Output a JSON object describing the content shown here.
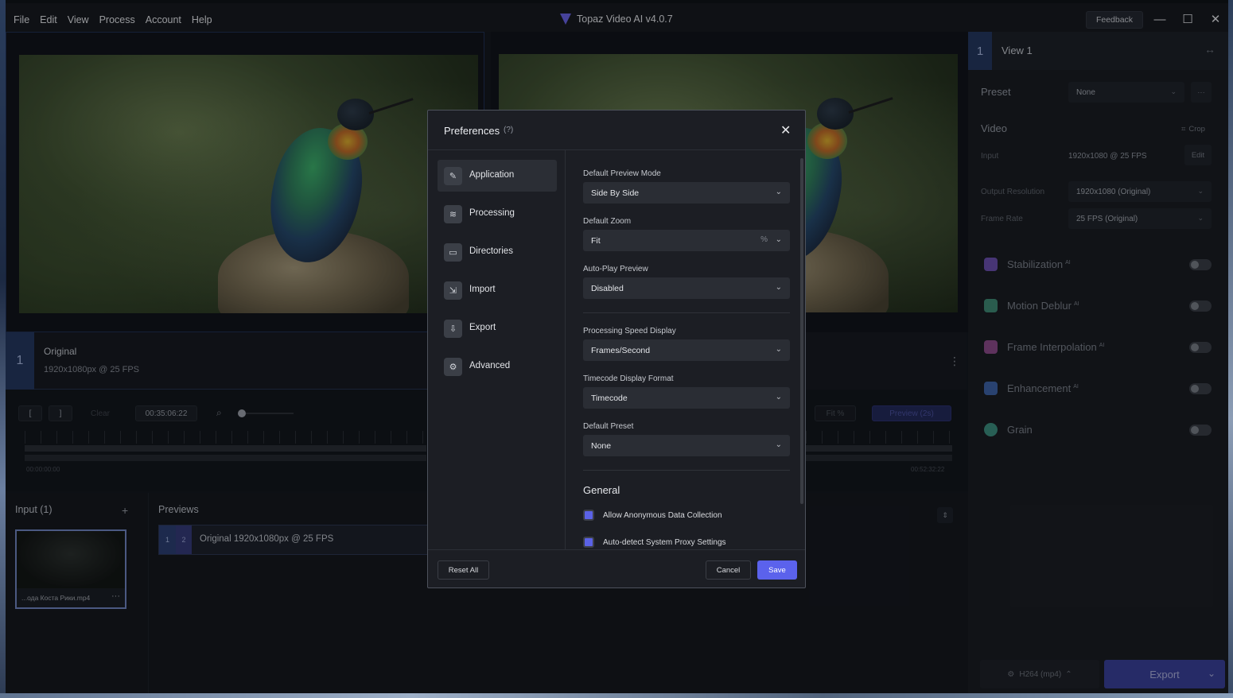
{
  "menu": [
    "File",
    "Edit",
    "View",
    "Process",
    "Account",
    "Help"
  ],
  "app_title": "Topaz Video AI  v4.0.7",
  "feedback_label": "Feedback",
  "window_controls": {
    "minimize": "—",
    "maximize": "☐",
    "close": "✕"
  },
  "view_strip": {
    "number": "1",
    "title": "Original",
    "subtitle": "1920x1080px @ 25 FPS"
  },
  "timeline": {
    "in_mark": "[",
    "out_mark": "]",
    "clear": "Clear",
    "timecode": "00:35:06:22",
    "start_tc": "00:00:00:00",
    "end_tc": "00:52:32:22",
    "fit": "Fit %",
    "preview": "Preview (2s)"
  },
  "input_panel": {
    "title": "Input (1)",
    "add": "+",
    "file_name": "...ода Коста Рики.mp4",
    "more": "···"
  },
  "previews_panel": {
    "title": "Previews",
    "num1": "1",
    "num2": "2",
    "row_label": "Original   1920x1080px @ 25 FPS",
    "sort": "⇕"
  },
  "sidebar": {
    "view_number": "1",
    "view_name": "View 1",
    "swap": "↔",
    "preset_label": "Preset",
    "preset_value": "None",
    "preset_more": "···",
    "video_label": "Video",
    "crop": "Crop",
    "input_label": "Input",
    "input_value": "1920x1080 @ 25 FPS",
    "edit": "Edit",
    "output_res_label": "Output Resolution",
    "output_res_value": "1920x1080 (Original)",
    "frame_rate_label": "Frame Rate",
    "frame_rate_value": "25 FPS (Original)",
    "features": [
      {
        "name": "Stabilization",
        "ai": "AI",
        "color": "#6c4fb0"
      },
      {
        "name": "Motion Deblur",
        "ai": "AI",
        "color": "#3f8a74"
      },
      {
        "name": "Frame Interpolation",
        "ai": "AI",
        "color": "#8f4b8a"
      },
      {
        "name": "Enhancement",
        "ai": "AI",
        "color": "#3e63a8"
      },
      {
        "name": "Grain",
        "ai": "",
        "color": "#3d8f7e"
      }
    ],
    "codec": "H264 (mp4)",
    "export": "Export"
  },
  "preferences": {
    "title": "Preferences",
    "help": "(?)",
    "close": "✕",
    "nav": [
      {
        "label": "Application",
        "icon": "✎"
      },
      {
        "label": "Processing",
        "icon": "≋"
      },
      {
        "label": "Directories",
        "icon": "▭"
      },
      {
        "label": "Import",
        "icon": "⇲"
      },
      {
        "label": "Export",
        "icon": "⇩"
      },
      {
        "label": "Advanced",
        "icon": "⚙"
      }
    ],
    "fields": [
      {
        "label": "Default Preview Mode",
        "value": "Side By Side"
      },
      {
        "label": "Default Zoom",
        "value": "Fit",
        "unit": "%"
      },
      {
        "label": "Auto-Play Preview",
        "value": "Disabled"
      },
      {
        "label": "Processing Speed Display",
        "value": "Frames/Second"
      },
      {
        "label": "Timecode Display Format",
        "value": "Timecode"
      },
      {
        "label": "Default Preset",
        "value": "None"
      }
    ],
    "general_title": "General",
    "checkboxes": [
      {
        "label": "Allow Anonymous Data Collection",
        "checked": true
      },
      {
        "label": "Auto-detect System Proxy Settings",
        "checked": true
      }
    ],
    "reset_all": "Reset All",
    "cancel": "Cancel",
    "save": "Save"
  }
}
